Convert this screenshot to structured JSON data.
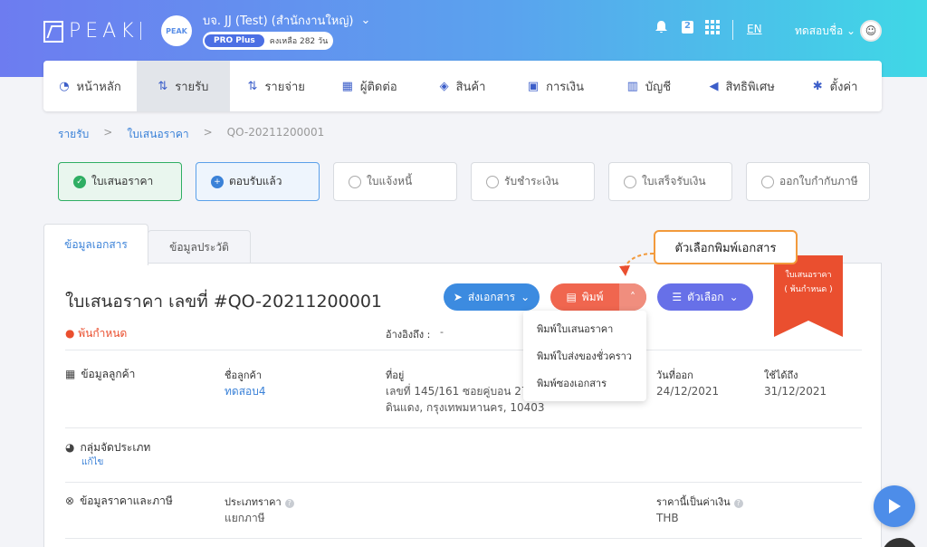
{
  "header": {
    "logo": "PEAK",
    "company_logo": "PEAK",
    "company_name": "บจ. JJ (Test) (สำนักงานใหญ่)",
    "plan": "PRO Plus",
    "remaining": "คงเหลือ 282 วัน",
    "badge_count": "2",
    "language": "EN",
    "user_name": "ทดสอบชื่อ"
  },
  "nav": [
    {
      "label": "หน้าหลัก",
      "icon": "dashboard-icon",
      "glyph": "◔"
    },
    {
      "label": "รายรับ",
      "icon": "income-icon",
      "glyph": "⇅"
    },
    {
      "label": "รายจ่าย",
      "icon": "expense-icon",
      "glyph": "⇅"
    },
    {
      "label": "ผู้ติดต่อ",
      "icon": "contacts-icon",
      "glyph": "▦"
    },
    {
      "label": "สินค้า",
      "icon": "product-icon",
      "glyph": "◈"
    },
    {
      "label": "การเงิน",
      "icon": "money-icon",
      "glyph": "▣"
    },
    {
      "label": "บัญชี",
      "icon": "book-icon",
      "glyph": "▥"
    },
    {
      "label": "สิทธิพิเศษ",
      "icon": "megaphone-icon",
      "glyph": "◀"
    },
    {
      "label": "ตั้งค่า",
      "icon": "gear-icon",
      "glyph": "✱"
    }
  ],
  "breadcrumb": {
    "level1": "รายรับ",
    "sep": ">",
    "level2": "ใบเสนอราคา",
    "level3": "QO-20211200001"
  },
  "steps": [
    {
      "label": "ใบเสนอราคา",
      "state": "done"
    },
    {
      "label": "ตอบรับแล้ว",
      "state": "current"
    },
    {
      "label": "ใบแจ้งหนี้",
      "state": "pending"
    },
    {
      "label": "รับชำระเงิน",
      "state": "pending"
    },
    {
      "label": "ใบเสร็จรับเงิน",
      "state": "pending"
    },
    {
      "label": "ออกใบกำกับภาษี",
      "state": "pending"
    }
  ],
  "tabs": {
    "document": "ข้อมูลเอกสาร",
    "history": "ข้อมูลประวัติ"
  },
  "document": {
    "title": "ใบเสนอราคา เลขที่ #QO-20211200001",
    "status": "พ้นกำหนด",
    "reference_label": "อ้างอิงถึง :",
    "reference_value": "-",
    "ribbon_line1": "ใบเสนอราคา",
    "ribbon_line2": "( พ้นกำหนด )"
  },
  "actions": {
    "send": "ส่งเอกสาร",
    "print": "พิมพ์",
    "options": "ตัวเลือก"
  },
  "print_menu": [
    "พิมพ์ใบเสนอราคา",
    "พิมพ์ใบส่งของชั่วคราว",
    "พิมพ์ซองเอกสาร"
  ],
  "callout": "ตัวเลือกพิมพ์เอกสาร",
  "customer": {
    "section": "ข้อมูลลูกค้า",
    "name_label": "ชื่อลูกค้า",
    "name_value": "ทดสอบ4",
    "address_label": "ที่อยู่",
    "address_line1": "เลขที่ 145/161 ซอยคู่บอน 27 แ",
    "address_line2": "ดินแดง, กรุงเทพมหานคร, 10403",
    "issue_label": "วันที่ออก",
    "issue_value": "24/12/2021",
    "valid_label": "ใช้ได้ถึง",
    "valid_value": "31/12/2021"
  },
  "group": {
    "section": "กลุ่มจัดประเภท",
    "edit": "แก้ไข"
  },
  "pricing": {
    "section": "ข้อมูลราคาและภาษี",
    "price_type_label": "ประเภทราคา",
    "price_type_value": "แยกภาษี",
    "currency_label": "ราคานี้เป็นค่าเงิน",
    "currency_value": "THB"
  },
  "colors": {
    "accent": "#3b82d8",
    "print": "#f0664f",
    "options": "#6770e8",
    "ribbon": "#ea4f2f",
    "callout_border": "#f29a3c",
    "done": "#2fae63",
    "overdue": "#ea4f2f"
  }
}
